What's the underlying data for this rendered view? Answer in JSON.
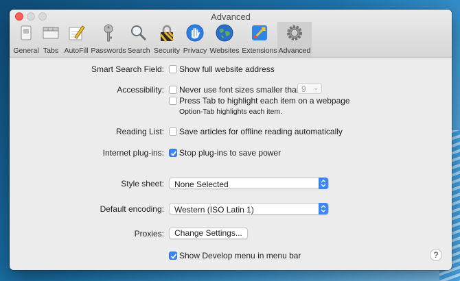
{
  "window": {
    "title": "Advanced"
  },
  "toolbar": {
    "tabs": [
      {
        "label": "General",
        "icon": "general-switch-icon"
      },
      {
        "label": "Tabs",
        "icon": "tabs-icon"
      },
      {
        "label": "AutoFill",
        "icon": "autofill-pencil-icon"
      },
      {
        "label": "Passwords",
        "icon": "key-icon"
      },
      {
        "label": "Search",
        "icon": "magnifier-icon"
      },
      {
        "label": "Security",
        "icon": "lock-icon"
      },
      {
        "label": "Privacy",
        "icon": "hand-icon"
      },
      {
        "label": "Websites",
        "icon": "globe-icon"
      },
      {
        "label": "Extensions",
        "icon": "puzzle-icon"
      },
      {
        "label": "Advanced",
        "icon": "gear-icon"
      }
    ],
    "selected": "Advanced"
  },
  "settings": {
    "smart_search": {
      "label": "Smart Search Field:",
      "option": "Show full website address",
      "checked": false
    },
    "accessibility": {
      "label": "Accessibility:",
      "option1": "Never use font sizes smaller than",
      "font_size": "9",
      "option2": "Press Tab to highlight each item on a webpage",
      "hint": "Option-Tab highlights each item."
    },
    "reading_list": {
      "label": "Reading List:",
      "option": "Save articles for offline reading automatically"
    },
    "plugins": {
      "label": "Internet plug-ins:",
      "option": "Stop plug-ins to save power",
      "checked": true
    },
    "style_sheet": {
      "label": "Style sheet:",
      "value": "None Selected"
    },
    "encoding": {
      "label": "Default encoding:",
      "value": "Western (ISO Latin 1)"
    },
    "proxies": {
      "label": "Proxies:",
      "button": "Change Settings..."
    },
    "develop_menu": {
      "option": "Show Develop menu in menu bar",
      "checked": true
    }
  },
  "help": {
    "label": "?"
  },
  "colors": {
    "accent": "#3b86f7",
    "close": "#fe5f57"
  }
}
